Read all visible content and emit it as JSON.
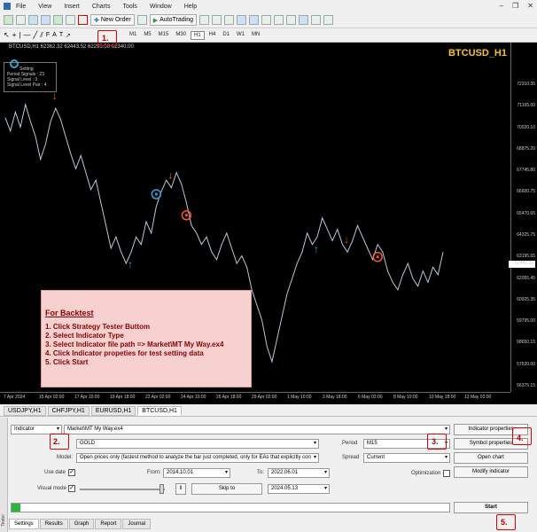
{
  "menu": {
    "items": [
      "File",
      "View",
      "Insert",
      "Charts",
      "Tools",
      "Window",
      "Help"
    ]
  },
  "toolbar": {
    "new_order": "New Order",
    "autotrading": "AutoTrading"
  },
  "timeframes": [
    "M1",
    "M5",
    "M15",
    "M30",
    "H1",
    "H4",
    "D1",
    "W1",
    "MN"
  ],
  "timeframe_active": "H1",
  "chart": {
    "header": "BTCUSD,H1  62362.32 62443.52 62295.50 62340.00",
    "symbol_label": "BTCUSD_H1",
    "current_price": "62443.52",
    "prices": [
      "72310.35",
      "71165.00",
      "70020.10",
      "68875.20",
      "67745.80",
      "66600.75",
      "65470.65",
      "64325.75",
      "63195.65",
      "62055.45",
      "60925.35",
      "59795.00",
      "58650.15",
      "57520.00",
      "56375.15"
    ],
    "times": [
      "7 Apr 2024",
      "15 Apr 02:00",
      "17 Apr 10:00",
      "19 Apr 18:00",
      "22 Apr 02:00",
      "24 Apr 10:00",
      "26 Apr 18:00",
      "29 Apr 02:00",
      "1 May 10:00",
      "3 May 18:00",
      "6 May 02:00",
      "8 May 10:00",
      "10 May 18:00",
      "13 May 02:00"
    ],
    "indicator_box": {
      "title": "Setting",
      "rows": [
        "Period Signals : 23",
        "Signal Level : 3",
        "Signal Level Pair : 4"
      ]
    },
    "price_series": [
      70400,
      69700,
      70700,
      69900,
      71100,
      70200,
      69400,
      68200,
      69000,
      70200,
      70900,
      70300,
      69400,
      68500,
      67700,
      68400,
      67500,
      66600,
      67100,
      65900,
      64700,
      63500,
      64100,
      63300,
      62700,
      63300,
      64100,
      63700,
      64900,
      64300,
      65700,
      66500,
      67100,
      66700,
      67500,
      66900,
      65900,
      64700,
      64300,
      63700,
      64100,
      63300,
      62900,
      63700,
      64300,
      63500,
      62700,
      63100,
      62500,
      61300,
      60500,
      59700,
      58300,
      57500,
      58700,
      59900,
      61100,
      61900,
      62700,
      63300,
      64300,
      63700,
      64100,
      65100,
      64500,
      63900,
      64500,
      63700,
      63300,
      63900,
      64700,
      64100,
      63500,
      62900,
      63700,
      63300,
      62300,
      61700,
      61300,
      62100,
      62700,
      61900,
      61500,
      62300,
      61700,
      62500,
      62100,
      63300
    ]
  },
  "note": {
    "heading": "For Backtest",
    "lines": [
      "1. Click Strategy Tester Buttom",
      "2. Select Indicator Type",
      "3. Select Indicator file path => Market\\MT My Way.ex4",
      "4. Click Indicator propeties for test setting data",
      "5. Click Start"
    ]
  },
  "chart_tabs": [
    "USDJPY,H1",
    "CHFJPY,H1",
    "EURUSD,H1",
    "BTCUSD,H1"
  ],
  "chart_tab_active": "BTCUSD,H1",
  "tester": {
    "side_label": "Tester",
    "type": "Indicator",
    "file": "Market\\MT My Way.ex4",
    "symbol": "GOLD",
    "period_label": "Period",
    "period": "M15",
    "model_label": "Model:",
    "model": "Open prices only (fastest method to analyze the bar just completed, only for EAs that explicitly con",
    "spread_label": "Spread",
    "spread": "Current",
    "use_date_label": "Use date",
    "from_label": "From:",
    "from": "2014.10.01",
    "to_label": "To:",
    "to": "2022.06.01",
    "visual_label": "Visual mode",
    "skip_label": "Skip to",
    "skip_date": "2024.05.13",
    "optimization_label": "Optimization",
    "btn_indicator_props": "Indicator properties",
    "btn_symbol_props": "Symbol properties",
    "btn_open_chart": "Open chart",
    "btn_modify": "Modify indicator",
    "btn_start": "Start",
    "progress_pct": 2
  },
  "bottom_tabs": [
    "Settings",
    "Results",
    "Graph",
    "Report",
    "Journal"
  ],
  "bottom_tab_active": "Settings",
  "callouts": [
    "1.",
    "2.",
    "3.",
    "4.",
    "5."
  ],
  "colors": {
    "note_bg": "#f7d0d0",
    "callout": "#dd0000",
    "sell_arrow": "#ff5a1f",
    "buy_arrow": "#29a8e0",
    "progress": "#27b83c"
  }
}
